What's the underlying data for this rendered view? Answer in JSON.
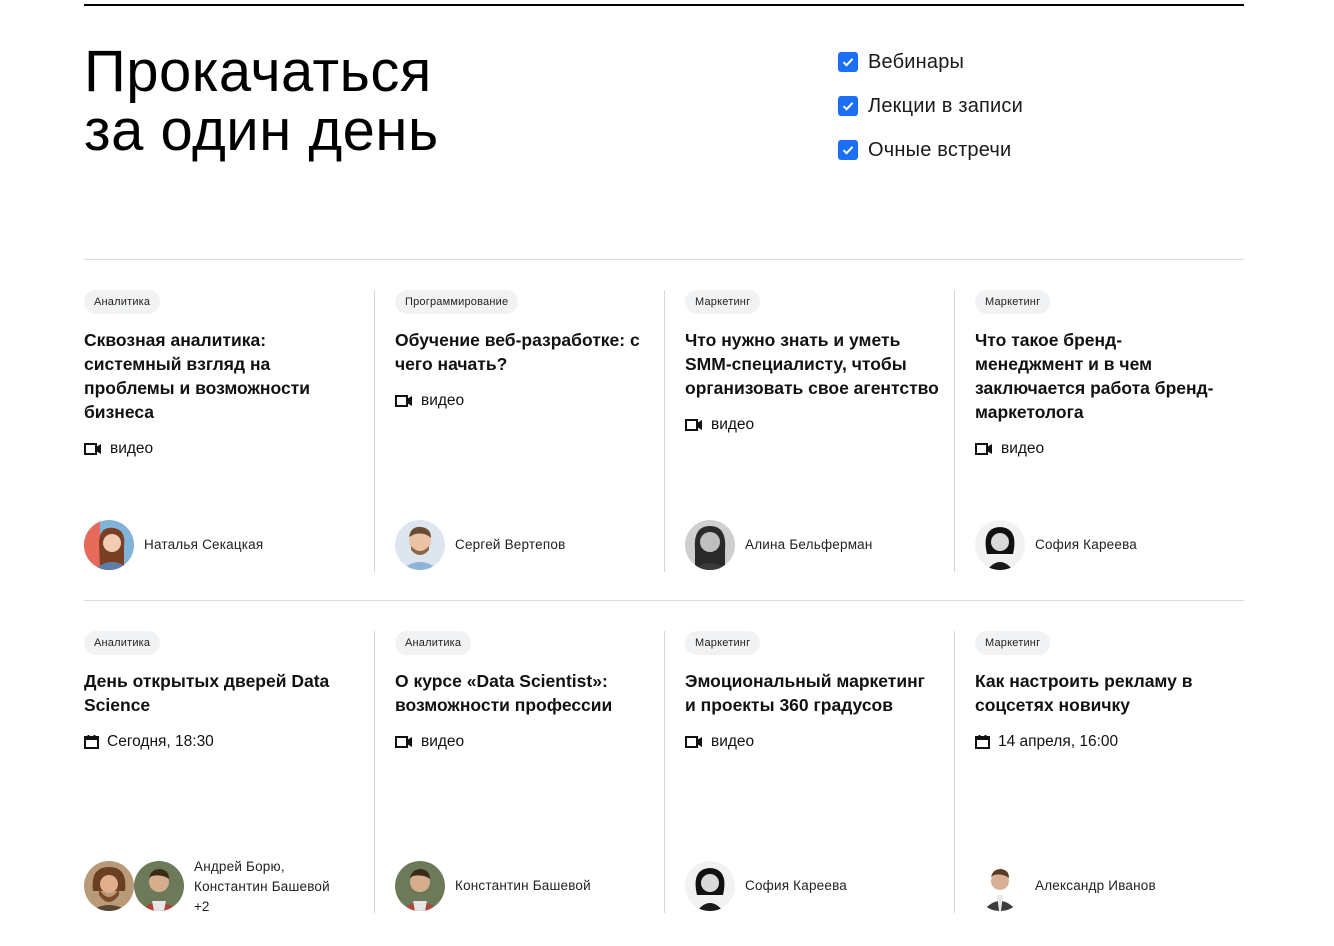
{
  "hero": {
    "title": "Прокачаться\nза один день"
  },
  "filters": [
    {
      "label": "Вебинары",
      "checked": true
    },
    {
      "label": "Лекции в записи",
      "checked": true
    },
    {
      "label": "Очные встречи",
      "checked": true
    }
  ],
  "colors": {
    "accent": "#1a6ff2",
    "tag_bg": "#f1f2f4",
    "divider": "#dcdcdc"
  },
  "cards": [
    {
      "tag": "Аналитика",
      "title": "Сквозная аналитика: системный взгляд на проблемы и возможности бизнеса",
      "meta_icon": "video-icon",
      "meta": "видео",
      "speaker": "Наталья Секацкая"
    },
    {
      "tag": "Программирование",
      "title": "Обучение веб-разработке: с чего начать?",
      "meta_icon": "video-icon",
      "meta": "видео",
      "speaker": "Сергей Вертепов"
    },
    {
      "tag": "Маркетинг",
      "title": "Что нужно знать и уметь SMM-специалисту, чтобы организовать свое агентство",
      "meta_icon": "video-icon",
      "meta": "видео",
      "speaker": "Алина Бельферман"
    },
    {
      "tag": "Маркетинг",
      "title": "Что такое бренд-менеджмент и в чем заключается работа бренд-маркетолога",
      "meta_icon": "video-icon",
      "meta": "видео",
      "speaker": "София Кареева"
    },
    {
      "tag": "Аналитика",
      "title": "День открытых дверей Data Science",
      "meta_icon": "calendar-icon",
      "meta": "Сегодня, 18:30",
      "speaker": "Андрей Борю,\nКонстантин Башевой",
      "speaker_extra": "+2"
    },
    {
      "tag": "Аналитика",
      "title": "О курсе «Data Scientist»: возможности профессии",
      "meta_icon": "video-icon",
      "meta": "видео",
      "speaker": "Константин Башевой"
    },
    {
      "tag": "Маркетинг",
      "title": "Эмоциональный маркетинг и проекты 360 градусов",
      "meta_icon": "video-icon",
      "meta": "видео",
      "speaker": "София Кареева"
    },
    {
      "tag": "Маркетинг",
      "title": "Как настроить рекламу в соцсетях новичку",
      "meta_icon": "calendar-icon",
      "meta": "14 апреля, 16:00",
      "speaker": "Александр Иванов"
    }
  ]
}
